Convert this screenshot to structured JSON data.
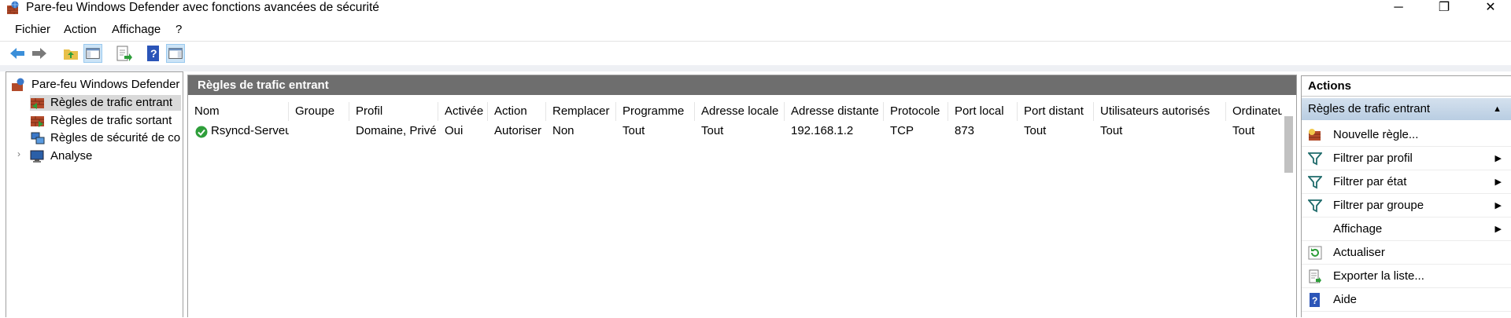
{
  "window": {
    "title": "Pare-feu Windows Defender avec fonctions avancées de sécurité",
    "minimize": "─",
    "maximize": "❐",
    "close": "✕"
  },
  "menu": [
    "Fichier",
    "Action",
    "Affichage",
    "?"
  ],
  "toolbar": {
    "icons": [
      "back-icon",
      "forward-icon",
      "up-folder-icon",
      "show-hide-tree-icon",
      "export-list-icon",
      "help-icon",
      "show-hide-action-pane-icon"
    ]
  },
  "tree": {
    "root": "Pare-feu Windows Defender avec fonctions avancées de sécurité",
    "items": [
      {
        "label": "Règles de trafic entrant",
        "selected": true
      },
      {
        "label": "Règles de trafic sortant"
      },
      {
        "label": "Règles de sécurité de connexion"
      },
      {
        "label": "Analyse",
        "expander": "›"
      }
    ]
  },
  "center": {
    "title": "Règles de trafic entrant",
    "columns": [
      "Nom",
      "Groupe",
      "Profil",
      "Activée",
      "Action",
      "Remplacer",
      "Programme",
      "Adresse locale",
      "Adresse distante",
      "Protocole",
      "Port local",
      "Port distant",
      "Utilisateurs autorisés",
      "Ordinateurs"
    ],
    "rows": [
      {
        "name": "Rsyncd-Serveur",
        "group": "",
        "profile": "Domaine, Privé",
        "enabled": "Oui",
        "action": "Autoriser",
        "override": "Non",
        "program": "Tout",
        "local_address": "Tout",
        "remote_address": "192.168.1.2",
        "protocol": "TCP",
        "local_port": "873",
        "remote_port": "Tout",
        "authorized_users": "Tout",
        "computers": "Tout"
      }
    ]
  },
  "actions": {
    "title": "Actions",
    "section": "Règles de trafic entrant",
    "items": [
      {
        "label": "Nouvelle règle...",
        "icon": "new-rule-icon"
      },
      {
        "label": "Filtrer par profil",
        "icon": "filter-icon",
        "submenu": true
      },
      {
        "label": "Filtrer par état",
        "icon": "filter-icon",
        "submenu": true
      },
      {
        "label": "Filtrer par groupe",
        "icon": "filter-icon",
        "submenu": true
      },
      {
        "label": "Affichage",
        "icon": "",
        "submenu": true
      },
      {
        "label": "Actualiser",
        "icon": "refresh-icon"
      },
      {
        "label": "Exporter la liste...",
        "icon": "export-icon"
      },
      {
        "label": "Aide",
        "icon": "help-icon"
      }
    ]
  },
  "colors": {
    "pane_header": "#6e6e6e",
    "selected_section": "#c7d7e8",
    "allow_green": "#2e9e3a"
  }
}
